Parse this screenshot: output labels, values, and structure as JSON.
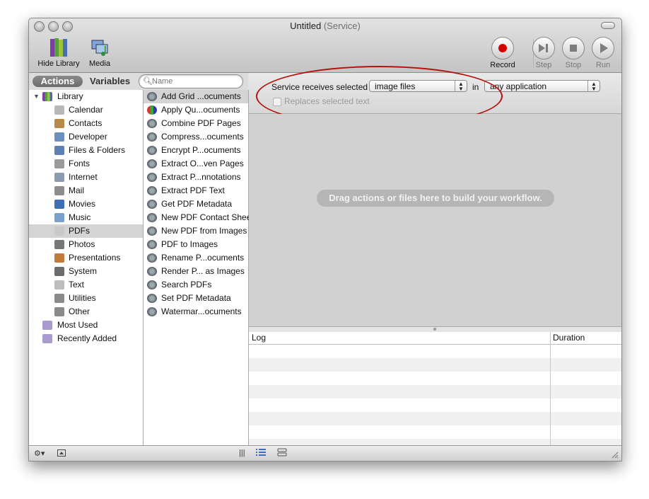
{
  "window": {
    "title": "Untitled",
    "subtitle": "(Service)"
  },
  "toolbar": {
    "hide_library": "Hide Library",
    "media": "Media",
    "record": "Record",
    "step": "Step",
    "stop": "Stop",
    "run": "Run"
  },
  "sidebar": {
    "tab_actions": "Actions",
    "tab_variables": "Variables",
    "search_placeholder": "Name",
    "library_label": "Library",
    "categories": [
      {
        "label": "Calendar",
        "icon": "calendar-icon",
        "color": "#b8b8b8"
      },
      {
        "label": "Contacts",
        "icon": "contacts-icon",
        "color": "#b58a4a"
      },
      {
        "label": "Developer",
        "icon": "developer-icon",
        "color": "#6d8fbf"
      },
      {
        "label": "Files & Folders",
        "icon": "files-folders-icon",
        "color": "#5d7fb5"
      },
      {
        "label": "Fonts",
        "icon": "fonts-icon",
        "color": "#9a9a9a"
      },
      {
        "label": "Internet",
        "icon": "internet-icon",
        "color": "#8b9bb0"
      },
      {
        "label": "Mail",
        "icon": "mail-icon",
        "color": "#8d8d8d"
      },
      {
        "label": "Movies",
        "icon": "movies-icon",
        "color": "#3f6fb5"
      },
      {
        "label": "Music",
        "icon": "music-icon",
        "color": "#7aa0cc"
      },
      {
        "label": "PDFs",
        "icon": "pdfs-icon",
        "color": "#c9c9c9"
      },
      {
        "label": "Photos",
        "icon": "photos-icon",
        "color": "#777777"
      },
      {
        "label": "Presentations",
        "icon": "presentations-icon",
        "color": "#c07a3a"
      },
      {
        "label": "System",
        "icon": "system-icon",
        "color": "#6c6c6c"
      },
      {
        "label": "Text",
        "icon": "text-icon",
        "color": "#bdbdbd"
      },
      {
        "label": "Utilities",
        "icon": "utilities-icon",
        "color": "#8a8a8a"
      },
      {
        "label": "Other",
        "icon": "other-icon",
        "color": "#8a8a8a"
      }
    ],
    "selected_category": "PDFs",
    "smart_groups": [
      {
        "label": "Most Used",
        "icon": "smart-folder-icon"
      },
      {
        "label": "Recently Added",
        "icon": "smart-folder-icon"
      }
    ]
  },
  "actions": [
    "Add Grid ...ocuments",
    "Apply Qu...ocuments",
    "Combine PDF Pages",
    "Compress...ocuments",
    "Encrypt P...ocuments",
    "Extract O...ven Pages",
    "Extract P...nnotations",
    "Extract PDF Text",
    "Get PDF Metadata",
    "New PDF Contact Sheet",
    "New PDF from Images",
    "PDF to Images",
    "Rename P...ocuments",
    "Render P... as Images",
    "Search PDFs",
    "Set PDF Metadata",
    "Watermar...ocuments"
  ],
  "service": {
    "receives_label": "Service receives selected",
    "input_type": "image files",
    "in_label": "in",
    "application": "any application",
    "replaces_label": "Replaces selected text"
  },
  "workflow": {
    "hint": "Drag actions or files here to build your workflow."
  },
  "log": {
    "col_log": "Log",
    "col_duration": "Duration"
  },
  "colors": {
    "record": "#d70000",
    "annotation_oval": "#b3120b",
    "selection": "#d4d4d4"
  }
}
